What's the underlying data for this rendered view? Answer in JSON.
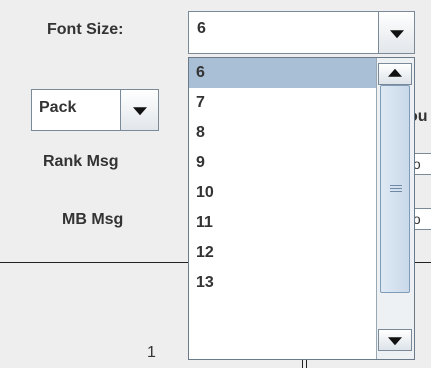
{
  "form": {
    "font_size_label": "Font Size:",
    "font_size_value": "6",
    "pack_value": "Pack",
    "partial_label": "ou",
    "rank_msg_label": "Rank Msg",
    "rank_msg_value": "fo",
    "mb_msg_label": "MB Msg",
    "mb_msg_value": "fo",
    "page_number": "1"
  },
  "dropdown": {
    "options": [
      "6",
      "7",
      "8",
      "9",
      "10",
      "11",
      "12",
      "13"
    ],
    "selected": "6"
  },
  "icons": {
    "combo_arrow": "chevron-down-icon",
    "scroll_up": "arrow-up-icon",
    "scroll_down": "arrow-down-icon"
  },
  "colors": {
    "selection": "#a9bfd6",
    "background": "#eeeeee"
  }
}
